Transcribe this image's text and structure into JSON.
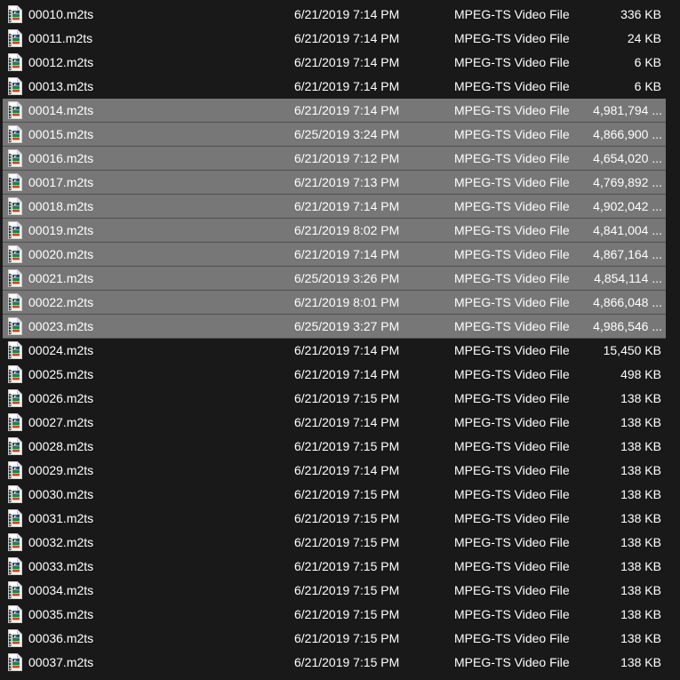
{
  "files": [
    {
      "name": "00010.m2ts",
      "date": "6/21/2019 7:14 PM",
      "type": "MPEG-TS Video File",
      "size": "336 KB",
      "selected": false
    },
    {
      "name": "00011.m2ts",
      "date": "6/21/2019 7:14 PM",
      "type": "MPEG-TS Video File",
      "size": "24 KB",
      "selected": false
    },
    {
      "name": "00012.m2ts",
      "date": "6/21/2019 7:14 PM",
      "type": "MPEG-TS Video File",
      "size": "6 KB",
      "selected": false
    },
    {
      "name": "00013.m2ts",
      "date": "6/21/2019 7:14 PM",
      "type": "MPEG-TS Video File",
      "size": "6 KB",
      "selected": false
    },
    {
      "name": "00014.m2ts",
      "date": "6/21/2019 7:14 PM",
      "type": "MPEG-TS Video File",
      "size": "4,981,794 ...",
      "selected": true
    },
    {
      "name": "00015.m2ts",
      "date": "6/25/2019 3:24 PM",
      "type": "MPEG-TS Video File",
      "size": "4,866,900 ...",
      "selected": true
    },
    {
      "name": "00016.m2ts",
      "date": "6/21/2019 7:12 PM",
      "type": "MPEG-TS Video File",
      "size": "4,654,020 ...",
      "selected": true
    },
    {
      "name": "00017.m2ts",
      "date": "6/21/2019 7:13 PM",
      "type": "MPEG-TS Video File",
      "size": "4,769,892 ...",
      "selected": true
    },
    {
      "name": "00018.m2ts",
      "date": "6/21/2019 7:14 PM",
      "type": "MPEG-TS Video File",
      "size": "4,902,042 ...",
      "selected": true
    },
    {
      "name": "00019.m2ts",
      "date": "6/21/2019 8:02 PM",
      "type": "MPEG-TS Video File",
      "size": "4,841,004 ...",
      "selected": true
    },
    {
      "name": "00020.m2ts",
      "date": "6/21/2019 7:14 PM",
      "type": "MPEG-TS Video File",
      "size": "4,867,164 ...",
      "selected": true
    },
    {
      "name": "00021.m2ts",
      "date": "6/25/2019 3:26 PM",
      "type": "MPEG-TS Video File",
      "size": "4,854,114 ...",
      "selected": true
    },
    {
      "name": "00022.m2ts",
      "date": "6/21/2019 8:01 PM",
      "type": "MPEG-TS Video File",
      "size": "4,866,048 ...",
      "selected": true
    },
    {
      "name": "00023.m2ts",
      "date": "6/25/2019 3:27 PM",
      "type": "MPEG-TS Video File",
      "size": "4,986,546 ...",
      "selected": true
    },
    {
      "name": "00024.m2ts",
      "date": "6/21/2019 7:14 PM",
      "type": "MPEG-TS Video File",
      "size": "15,450 KB",
      "selected": false
    },
    {
      "name": "00025.m2ts",
      "date": "6/21/2019 7:14 PM",
      "type": "MPEG-TS Video File",
      "size": "498 KB",
      "selected": false
    },
    {
      "name": "00026.m2ts",
      "date": "6/21/2019 7:15 PM",
      "type": "MPEG-TS Video File",
      "size": "138 KB",
      "selected": false
    },
    {
      "name": "00027.m2ts",
      "date": "6/21/2019 7:14 PM",
      "type": "MPEG-TS Video File",
      "size": "138 KB",
      "selected": false
    },
    {
      "name": "00028.m2ts",
      "date": "6/21/2019 7:15 PM",
      "type": "MPEG-TS Video File",
      "size": "138 KB",
      "selected": false
    },
    {
      "name": "00029.m2ts",
      "date": "6/21/2019 7:14 PM",
      "type": "MPEG-TS Video File",
      "size": "138 KB",
      "selected": false
    },
    {
      "name": "00030.m2ts",
      "date": "6/21/2019 7:15 PM",
      "type": "MPEG-TS Video File",
      "size": "138 KB",
      "selected": false
    },
    {
      "name": "00031.m2ts",
      "date": "6/21/2019 7:15 PM",
      "type": "MPEG-TS Video File",
      "size": "138 KB",
      "selected": false
    },
    {
      "name": "00032.m2ts",
      "date": "6/21/2019 7:15 PM",
      "type": "MPEG-TS Video File",
      "size": "138 KB",
      "selected": false
    },
    {
      "name": "00033.m2ts",
      "date": "6/21/2019 7:15 PM",
      "type": "MPEG-TS Video File",
      "size": "138 KB",
      "selected": false
    },
    {
      "name": "00034.m2ts",
      "date": "6/21/2019 7:15 PM",
      "type": "MPEG-TS Video File",
      "size": "138 KB",
      "selected": false
    },
    {
      "name": "00035.m2ts",
      "date": "6/21/2019 7:15 PM",
      "type": "MPEG-TS Video File",
      "size": "138 KB",
      "selected": false
    },
    {
      "name": "00036.m2ts",
      "date": "6/21/2019 7:15 PM",
      "type": "MPEG-TS Video File",
      "size": "138 KB",
      "selected": false
    },
    {
      "name": "00037.m2ts",
      "date": "6/21/2019 7:15 PM",
      "type": "MPEG-TS Video File",
      "size": "138 KB",
      "selected": false
    }
  ],
  "icon": "video-file-icon",
  "colors": {
    "background": "#191919",
    "selection": "#777777",
    "text": "#ffffff"
  }
}
